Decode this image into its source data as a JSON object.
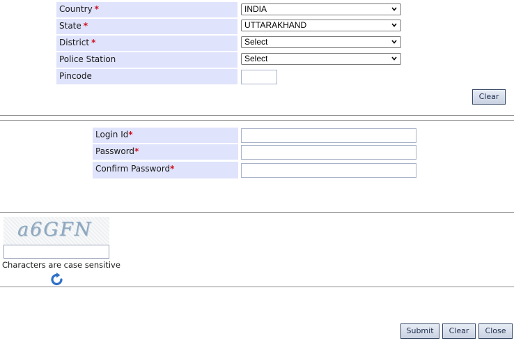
{
  "address": {
    "country": {
      "label": "Country",
      "required": "*",
      "value": "INDIA"
    },
    "state": {
      "label": "State",
      "required": "*",
      "value": "UTTARAKHAND"
    },
    "district": {
      "label": "District",
      "required": "*",
      "value": "Select"
    },
    "police_station": {
      "label": "Police Station",
      "value": "Select"
    },
    "pincode": {
      "label": "Pincode",
      "value": ""
    },
    "clear_label": "Clear"
  },
  "login": {
    "login_id": {
      "label": "Login Id",
      "required": "*",
      "value": ""
    },
    "password": {
      "label": "Password",
      "required": "*",
      "value": ""
    },
    "confirm_password": {
      "label": "Confirm Password",
      "required": "*",
      "value": ""
    }
  },
  "captcha": {
    "image_text": "a6GFN",
    "input_value": "",
    "note": "Characters are case sensitive",
    "refresh_icon": "refresh-icon"
  },
  "footer": {
    "submit_label": "Submit",
    "clear_label": "Clear",
    "close_label": "Close"
  },
  "colors": {
    "label_bg": "#dfe3fb",
    "required": "#d01020",
    "button_border": "#3a4a66"
  }
}
